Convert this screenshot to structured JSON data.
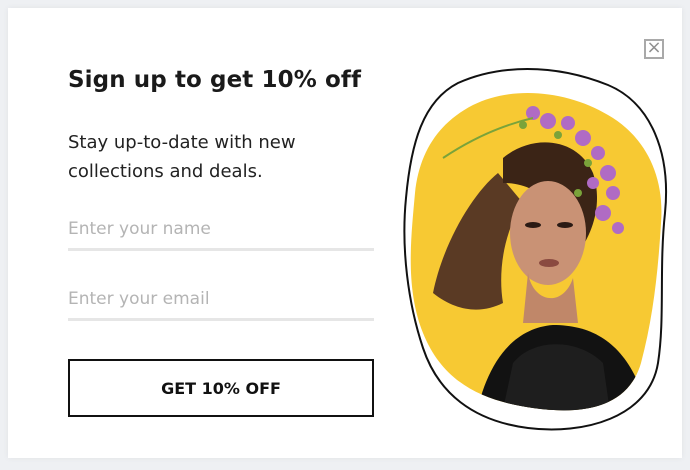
{
  "popup": {
    "title": "Sign up to get 10% off",
    "subtitle": "Stay up-to-date with new collections and deals.",
    "name_placeholder": "Enter your name",
    "email_placeholder": "Enter your email",
    "cta_label": "GET 10% OFF",
    "close_glyph": "×"
  },
  "colors": {
    "blob_yellow": "#f7c933",
    "button_border": "#111111",
    "field_underline": "#e6e6e6"
  },
  "icons": [
    "close-icon"
  ]
}
